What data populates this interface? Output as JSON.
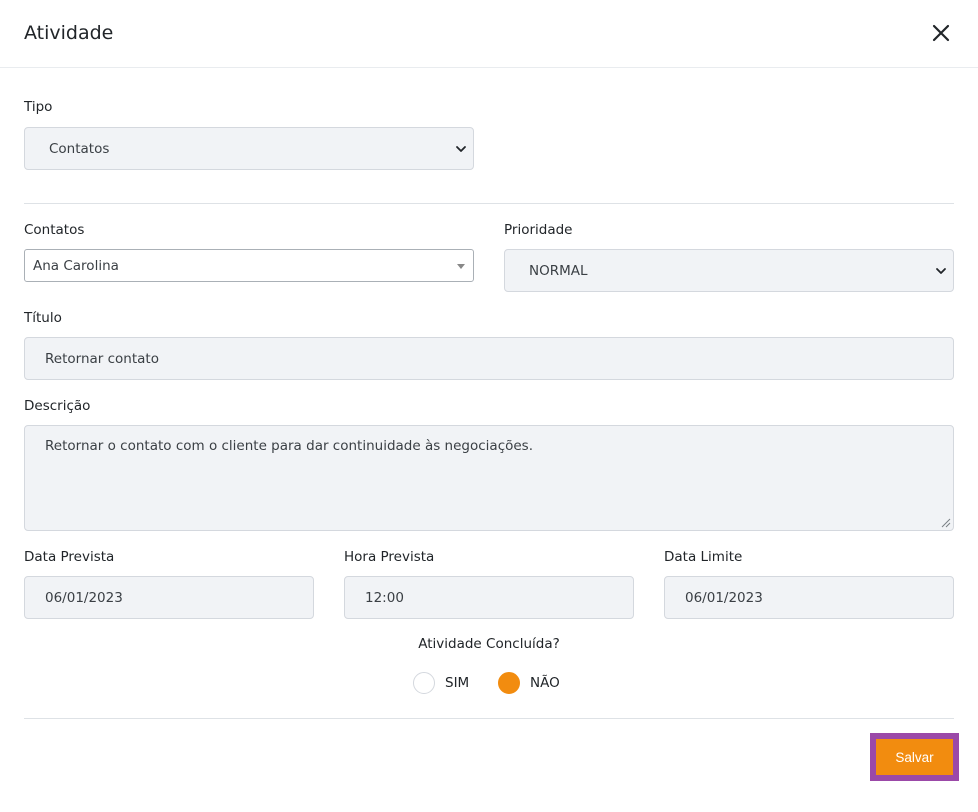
{
  "modal": {
    "title": "Atividade"
  },
  "icons": {
    "close": "close-icon",
    "select": "chevron-down-icon",
    "combo": "caret-down-icon"
  },
  "colors": {
    "accent": "#f28c0f",
    "highlight": "#9b49a8",
    "field_bg": "#f1f3f6"
  },
  "form": {
    "tipo": {
      "label": "Tipo",
      "value": "Contatos"
    },
    "contatos": {
      "label": "Contatos",
      "value": "Ana Carolina"
    },
    "prioridade": {
      "label": "Prioridade",
      "value": "NORMAL"
    },
    "titulo": {
      "label": "Título",
      "value": "Retornar contato"
    },
    "descricao": {
      "label": "Descrição",
      "value": "Retornar o contato com o cliente para dar continuidade às negociações."
    },
    "data_prevista": {
      "label": "Data Prevista",
      "value": "06/01/2023"
    },
    "hora_prevista": {
      "label": "Hora Prevista",
      "value": "12:00"
    },
    "data_limite": {
      "label": "Data Limite",
      "value": "06/01/2023"
    },
    "concluida": {
      "question": "Atividade Concluída?",
      "options": [
        {
          "label": "SIM",
          "selected": false
        },
        {
          "label": "NÃO",
          "selected": true
        }
      ]
    }
  },
  "footer": {
    "save_label": "Salvar"
  }
}
